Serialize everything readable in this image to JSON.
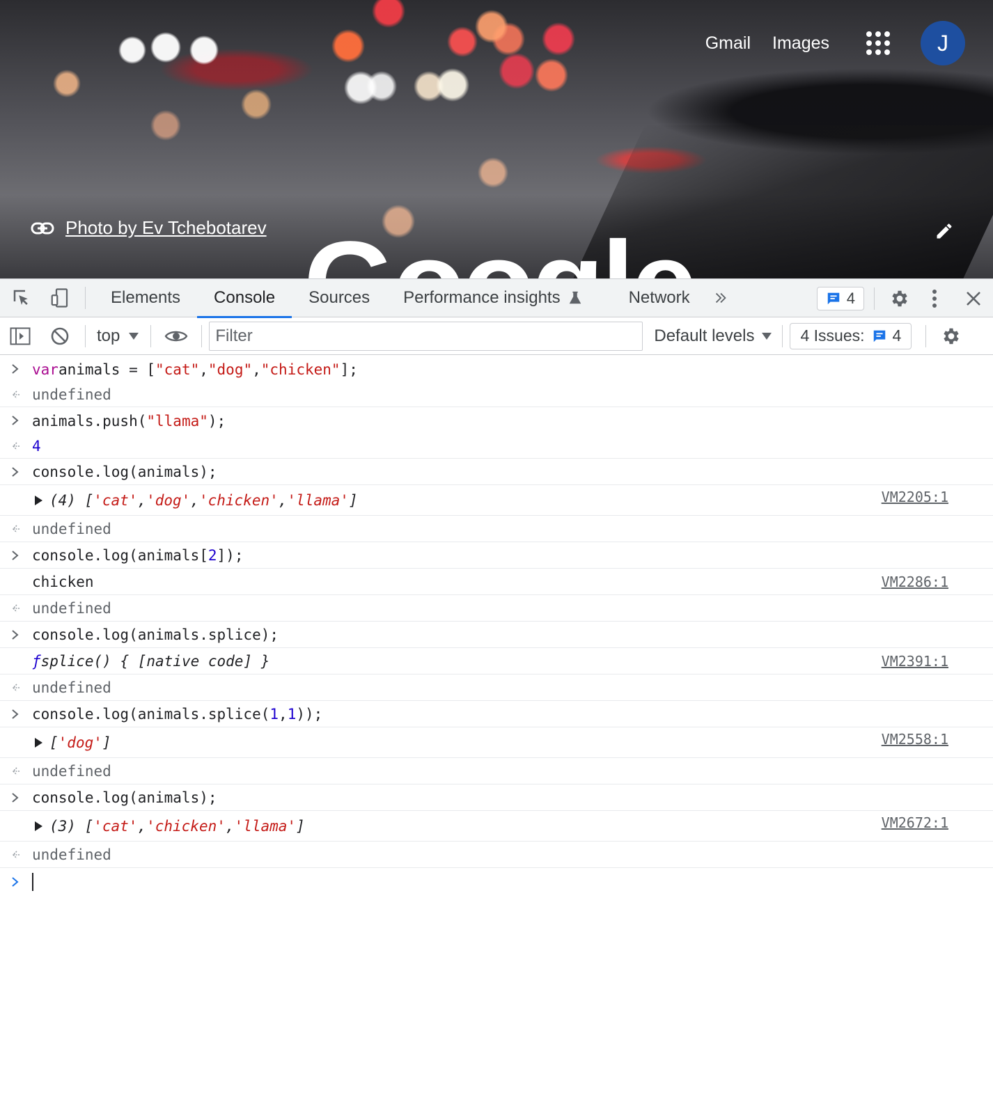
{
  "google": {
    "links": {
      "gmail": "Gmail",
      "images": "Images"
    },
    "avatar_initial": "J",
    "photo_credit": "Photo by Ev Tchebotarev",
    "logo_partial": "Google"
  },
  "devtools": {
    "tabs": [
      "Elements",
      "Console",
      "Sources",
      "Performance insights",
      "Network"
    ],
    "active_tab": "Console",
    "messages_badge": "4",
    "toolbar": {
      "context": "top",
      "filter_placeholder": "Filter",
      "levels": "Default levels",
      "issues_label": "4 Issues:",
      "issues_count": "4"
    }
  },
  "console": {
    "lines": {
      "l1_kw": "var",
      "l1_rest1": " animals = [",
      "l1_s1": "\"cat\"",
      "l1_c1": ", ",
      "l1_s2": "\"dog\"",
      "l1_c2": ", ",
      "l1_s3": "\"chicken\"",
      "l1_end": "];",
      "r1": "undefined",
      "l2_a": "animals.push(",
      "l2_s": "\"llama\"",
      "l2_b": ");",
      "r2": "4",
      "l3": "console.log(animals);",
      "o3_prefix": "(4) [",
      "o3_s1": "'cat'",
      "o3_s2": "'dog'",
      "o3_s3": "'chicken'",
      "o3_s4": "'llama'",
      "o3_sep": ", ",
      "o3_end": "]",
      "o3_src": "VM2205:1",
      "r3": "undefined",
      "l4_a": "console.log(animals[",
      "l4_n": "2",
      "l4_b": "]);",
      "o4": "chicken",
      "o4_src": "VM2286:1",
      "r4": "undefined",
      "l5": "console.log(animals.splice);",
      "o5_f": "ƒ",
      "o5_rest": " splice() { [native code] }",
      "o5_src": "VM2391:1",
      "r5": "undefined",
      "l6_a": "console.log(animals.splice(",
      "l6_n1": "1",
      "l6_c": ",",
      "l6_n2": "1",
      "l6_b": "));",
      "o6_prefix": "[",
      "o6_s1": "'dog'",
      "o6_end": "]",
      "o6_src": "VM2558:1",
      "r6": "undefined",
      "l7": "console.log(animals);",
      "o7_prefix": "(3) [",
      "o7_s1": "'cat'",
      "o7_s2": "'chicken'",
      "o7_s3": "'llama'",
      "o7_sep": ", ",
      "o7_end": "]",
      "o7_src": "VM2672:1",
      "r7": "undefined"
    }
  },
  "colors": {
    "accent": "#1a73e8",
    "keyword": "#aa0d91",
    "string": "#c41a16",
    "number": "#1c00cf",
    "avatar": "#1e4fa0"
  }
}
